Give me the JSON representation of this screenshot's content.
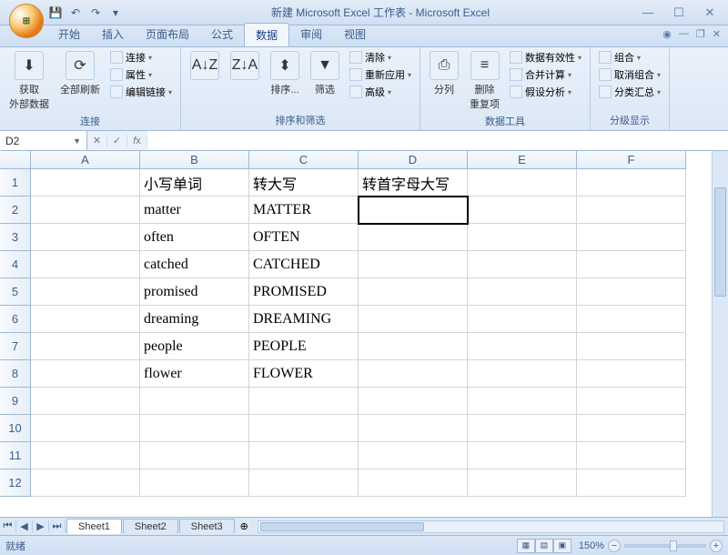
{
  "window": {
    "title": "新建 Microsoft Excel 工作表 - Microsoft Excel",
    "qat": {
      "save": "💾",
      "undo": "↶",
      "redo": "↷"
    }
  },
  "tabs": [
    "开始",
    "插入",
    "页面布局",
    "公式",
    "数据",
    "审阅",
    "视图"
  ],
  "active_tab_index": 4,
  "ribbon": {
    "groups": [
      {
        "label": "连接",
        "big": [
          {
            "name": "get-external",
            "label": "获取\n外部数据",
            "icon": "⬇"
          },
          {
            "name": "refresh-all",
            "label": "全部刷新",
            "icon": "⟳"
          }
        ],
        "small": [
          {
            "name": "connections",
            "label": "连接"
          },
          {
            "name": "properties",
            "label": "属性"
          },
          {
            "name": "edit-links",
            "label": "编辑链接"
          }
        ]
      },
      {
        "label": "排序和筛选",
        "big": [
          {
            "name": "sort-asc",
            "label": "",
            "icon": "A↓Z"
          },
          {
            "name": "sort-desc",
            "label": "",
            "icon": "Z↓A"
          },
          {
            "name": "sort",
            "label": "排序...",
            "icon": "⬍"
          },
          {
            "name": "filter",
            "label": "筛选",
            "icon": "▼"
          }
        ],
        "small": [
          {
            "name": "clear",
            "label": "清除"
          },
          {
            "name": "reapply",
            "label": "重新应用"
          },
          {
            "name": "advanced",
            "label": "高级"
          }
        ]
      },
      {
        "label": "数据工具",
        "big": [
          {
            "name": "text-to-columns",
            "label": "分列",
            "icon": "⎙"
          },
          {
            "name": "remove-duplicates",
            "label": "删除\n重复项",
            "icon": "≡"
          }
        ],
        "small": [
          {
            "name": "data-validation",
            "label": "数据有效性"
          },
          {
            "name": "consolidate",
            "label": "合并计算"
          },
          {
            "name": "what-if",
            "label": "假设分析"
          }
        ]
      },
      {
        "label": "分级显示",
        "big": [],
        "small": [
          {
            "name": "group",
            "label": "组合"
          },
          {
            "name": "ungroup",
            "label": "取消组合"
          },
          {
            "name": "subtotal",
            "label": "分类汇总"
          }
        ]
      }
    ]
  },
  "namebox": "D2",
  "formula": "",
  "columns": [
    "A",
    "B",
    "C",
    "D",
    "E",
    "F"
  ],
  "rows": [
    1,
    2,
    3,
    4,
    5,
    6,
    7,
    8,
    9,
    10,
    11,
    12
  ],
  "cells": {
    "B1": "小写单词",
    "C1": "转大写",
    "D1": "转首字母大写",
    "B2": "matter",
    "C2": "MATTER",
    "B3": "often",
    "C3": "OFTEN",
    "B4": "catched",
    "C4": "CATCHED",
    "B5": "promised",
    "C5": "PROMISED",
    "B6": "dreaming",
    "C6": "DREAMING",
    "B7": "people",
    "C7": "PEOPLE",
    "B8": "flower",
    "C8": "FLOWER"
  },
  "selected_cell": "D2",
  "sheets": [
    "Sheet1",
    "Sheet2",
    "Sheet3"
  ],
  "active_sheet": 0,
  "status": {
    "ready": "就绪",
    "zoom": "150%"
  }
}
